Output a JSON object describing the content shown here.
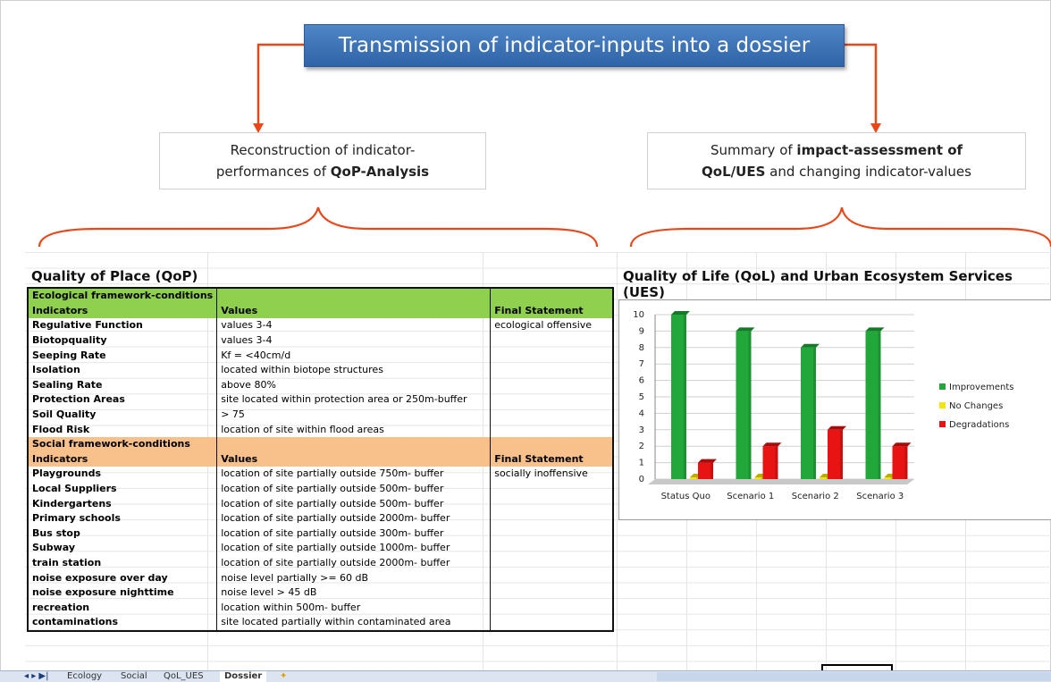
{
  "banner": {
    "title": "Transmission of indicator-inputs into a dossier"
  },
  "left_box": {
    "line1": "Reconstruction of indicator-",
    "line2_prefix": "performances of ",
    "line2_bold": "QoP-Analysis"
  },
  "right_box": {
    "line1_prefix": "Summary of ",
    "line1_bold": "impact-assessment of",
    "line2_bold": "QoL/UES",
    "line2_suffix": " and changing indicator-values"
  },
  "qop": {
    "title": "Quality of Place (QoP)",
    "eco_section": "Ecological framework-conditions",
    "eco_header": [
      "Indicators",
      "Values",
      "Final Statement"
    ],
    "eco_rows": [
      [
        "Regulative Function",
        "values 3-4",
        "ecological offensive"
      ],
      [
        "Biotopquality",
        "values 3-4",
        ""
      ],
      [
        "Seeping Rate",
        "Kf = <40cm/d",
        ""
      ],
      [
        "Isolation",
        "located within biotope structures",
        ""
      ],
      [
        "Sealing Rate",
        "above 80%",
        ""
      ],
      [
        "Protection Areas",
        "site located within protection area or 250m-buffer",
        ""
      ],
      [
        "Soil Quality",
        "> 75",
        ""
      ],
      [
        "Flood Risk",
        "location of site within flood areas",
        ""
      ]
    ],
    "soc_section": "Social framework-conditions",
    "soc_header": [
      "Indicators",
      "Values",
      "Final Statement"
    ],
    "soc_rows": [
      [
        "Playgrounds",
        "location of site partially outside 750m- buffer",
        "socially inoffensive"
      ],
      [
        "Local Suppliers",
        "location of site partially outside 500m- buffer",
        ""
      ],
      [
        "Kindergartens",
        "location of site partially outside 500m- buffer",
        ""
      ],
      [
        "Primary schools",
        "location of site partially outside 2000m- buffer",
        ""
      ],
      [
        "Bus stop",
        "location of site partially outside 300m- buffer",
        ""
      ],
      [
        "Subway",
        "location of site partially outside 1000m- buffer",
        ""
      ],
      [
        "train station",
        "location of site partially outside 2000m- buffer",
        ""
      ],
      [
        "noise exposure over day",
        "noise level partially >= 60 dB",
        ""
      ],
      [
        "noise exposure nighttime",
        "noise level > 45 dB",
        ""
      ],
      [
        "recreation",
        "location within 500m- buffer",
        ""
      ],
      [
        "contaminations",
        "site located partially within contaminated area",
        ""
      ]
    ]
  },
  "qol_title": "Quality of Life (QoL) and Urban Ecosystem Services (UES)",
  "chart_data": {
    "type": "bar",
    "categories": [
      "Status Quo",
      "Scenario 1",
      "Scenario 2",
      "Scenario 3"
    ],
    "series": [
      {
        "name": "Improvements",
        "values": [
          10,
          9,
          8,
          9
        ],
        "color": "#22a83a"
      },
      {
        "name": "No Changes",
        "values": [
          0,
          0,
          0,
          0
        ],
        "color": "#f2e60c"
      },
      {
        "name": "Degradations",
        "values": [
          1,
          2,
          3,
          2
        ],
        "color": "#e81414"
      }
    ],
    "ylim": [
      0,
      10
    ],
    "yticks": [
      "0",
      "1",
      "2",
      "3",
      "4",
      "5",
      "6",
      "7",
      "8",
      "9",
      "10"
    ],
    "legend": "right"
  },
  "tabs": [
    "Ecology",
    "Social",
    "QoL_UES",
    "Dossier"
  ],
  "active_tab": "Dossier",
  "tab_nav": "◂ ▸ ▶|"
}
